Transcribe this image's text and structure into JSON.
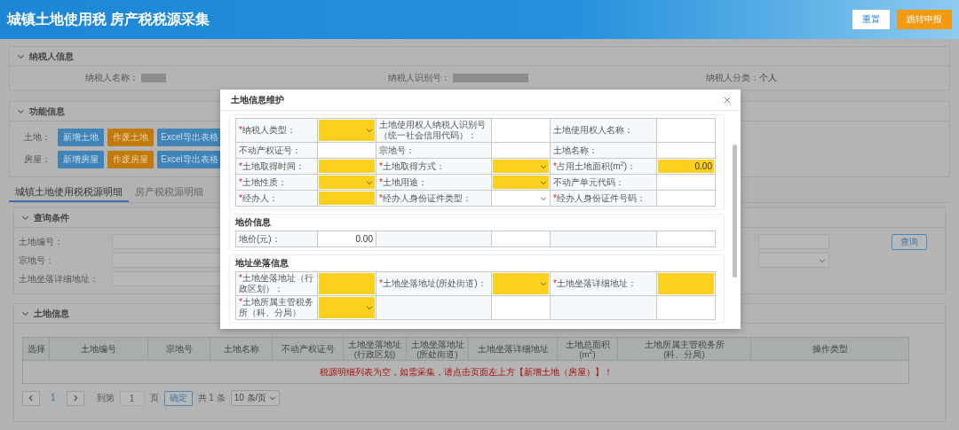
{
  "header": {
    "title": "城镇土地使用税 房产税税源采集",
    "buttons": [
      {
        "label": "重置",
        "kind": "secondary"
      },
      {
        "label": "跳转申报",
        "kind": "primary"
      }
    ]
  },
  "taxpayer_panel": {
    "title": "纳税人信息",
    "expanded": true,
    "fields": [
      {
        "label": "纳税人名称：",
        "redacted": true
      },
      {
        "label": "纳税人识别号：",
        "redacted": true
      },
      {
        "label": "纳税人分类：",
        "value": "个人"
      }
    ]
  },
  "function_panel": {
    "title": "功能信息",
    "expanded": true,
    "rows": [
      {
        "label": "土地：",
        "buttons": [
          {
            "label": "新增土地",
            "kind": "add"
          },
          {
            "label": "作废土地",
            "kind": "void"
          },
          {
            "label": "Excel导出表格",
            "kind": "export"
          }
        ]
      },
      {
        "label": "房屋：",
        "buttons": [
          {
            "label": "新增房屋",
            "kind": "add"
          },
          {
            "label": "作废房屋",
            "kind": "void"
          },
          {
            "label": "Excel导出表格",
            "kind": "export"
          }
        ]
      }
    ]
  },
  "detail_tabs": [
    {
      "label": "城镇土地使用税税源明细",
      "selected": true
    },
    {
      "label": "房产税税源明细",
      "selected": false
    }
  ],
  "query_panel": {
    "title": "查询条件",
    "expanded": true,
    "rows": [
      {
        "label": "土地编号：",
        "right_field": {
          "kind": "text"
        },
        "button": "查询"
      },
      {
        "label": "宗地号：",
        "right_field": {
          "kind": "select"
        }
      },
      {
        "label": "土地坐落详细地址："
      }
    ]
  },
  "land_panel": {
    "title": "土地信息",
    "expanded": true,
    "columns": [
      "选择",
      "土地编号",
      "宗地号",
      "土地名称",
      "不动产权证号",
      "土地坐落地址\n(行政区划)",
      "土地坐落地址\n(所处街道)",
      "土地坐落详细地址",
      "土地总面积(m$^{2}$)",
      "土地所属主管税务所\n(科、分局)",
      "操作类型"
    ],
    "empty_message": "税源明细列表为空，如需采集，请点击页面左上方【新增土地（房屋）】！",
    "pagination": {
      "current_page": "1",
      "goto_label": "到第",
      "goto_value": "1",
      "page_unit": "页",
      "confirm": "确定",
      "total": "共 1 条",
      "page_size": "10 条/页"
    }
  },
  "modal": {
    "title": "土地信息维护",
    "sections": [
      {
        "rows": [
          {
            "cells": [
              {
                "mark": "*",
                "label": "纳税人类型：",
                "field": {
                  "kind": "select",
                  "highlighted": true
                }
              },
              {
                "label": "土地使用权人纳税人识别号（统一社会信用代码）：",
                "field": {
                  "kind": "text",
                  "highlighted": false
                }
              },
              {
                "label": "土地使用权人名称：",
                "field": {
                  "kind": "text",
                  "highlighted": false
                }
              }
            ]
          },
          {
            "cells": [
              {
                "label": "不动产权证号：",
                "field": {
                  "kind": "text",
                  "highlighted": false
                }
              },
              {
                "label": "宗地号：",
                "field": {
                  "kind": "text",
                  "highlighted": false
                }
              },
              {
                "label": "土地名称：",
                "field": {
                  "kind": "text",
                  "highlighted": false
                }
              }
            ]
          },
          {
            "cells": [
              {
                "mark": "*",
                "label": "土地取得时间：",
                "field": {
                  "kind": "text",
                  "highlighted": true
                }
              },
              {
                "mark": "*",
                "label": "土地取得方式：",
                "field": {
                  "kind": "select",
                  "highlighted": true
                }
              },
              {
                "mark": "*",
                "label": "占用土地面积(m$^{2}$)：",
                "field": {
                  "kind": "text",
                  "highlighted": true,
                  "value": "0.00"
                }
              }
            ]
          },
          {
            "cells": [
              {
                "mark": "*",
                "label": "土地性质：",
                "field": {
                  "kind": "select",
                  "highlighted": true
                }
              },
              {
                "mark": "*",
                "label": "土地用途：",
                "field": {
                  "kind": "select",
                  "highlighted": true
                }
              },
              {
                "label": "不动产单元代码：",
                "field": {
                  "kind": "text",
                  "highlighted": false
                }
              }
            ]
          },
          {
            "cells": [
              {
                "mark": "*",
                "label": "经办人：",
                "field": {
                  "kind": "text",
                  "highlighted": true
                }
              },
              {
                "mark": "*",
                "label": "经办人身份证件类型：",
                "field": {
                  "kind": "select",
                  "highlighted": false
                }
              },
              {
                "mark": "*",
                "label": "经办人身份证件号码：",
                "field": {
                  "kind": "text",
                  "highlighted": false
                }
              }
            ]
          }
        ]
      },
      {
        "title": "地价信息",
        "rows": [
          {
            "cells": [
              {
                "label": "地价(元)：",
                "field": {
                  "kind": "text",
                  "highlighted": false,
                  "value": "0.00"
                }
              },
              {
                "field": {
                  "kind": "text",
                  "highlighted": false
                }
              },
              {
                "field": {
                  "kind": "text",
                  "highlighted": false
                }
              }
            ]
          }
        ]
      },
      {
        "title": "地址坐落信息",
        "rows": [
          {
            "cells": [
              {
                "mark": "*",
                "label": "土地坐落地址（行政区划）：",
                "field": {
                  "kind": "text",
                  "highlighted": true
                }
              },
              {
                "mark": "*",
                "label": "土地坐落地址(所处街道)：",
                "field": {
                  "kind": "select",
                  "highlighted": true
                }
              },
              {
                "mark": "*",
                "label": "土地坐落详细地址：",
                "field": {
                  "kind": "text",
                  "highlighted": true
                }
              }
            ]
          },
          {
            "cells": [
              {
                "mark": "*",
                "label": "土地所属主管税务所（科、分局）",
                "field": {
                  "kind": "select",
                  "highlighted": true
                }
              },
              {
                "field": {
                  "kind": "text",
                  "highlighted": false
                }
              },
              {
                "field": {
                  "kind": "text",
                  "highlighted": false
                }
              }
            ]
          }
        ]
      }
    ]
  }
}
